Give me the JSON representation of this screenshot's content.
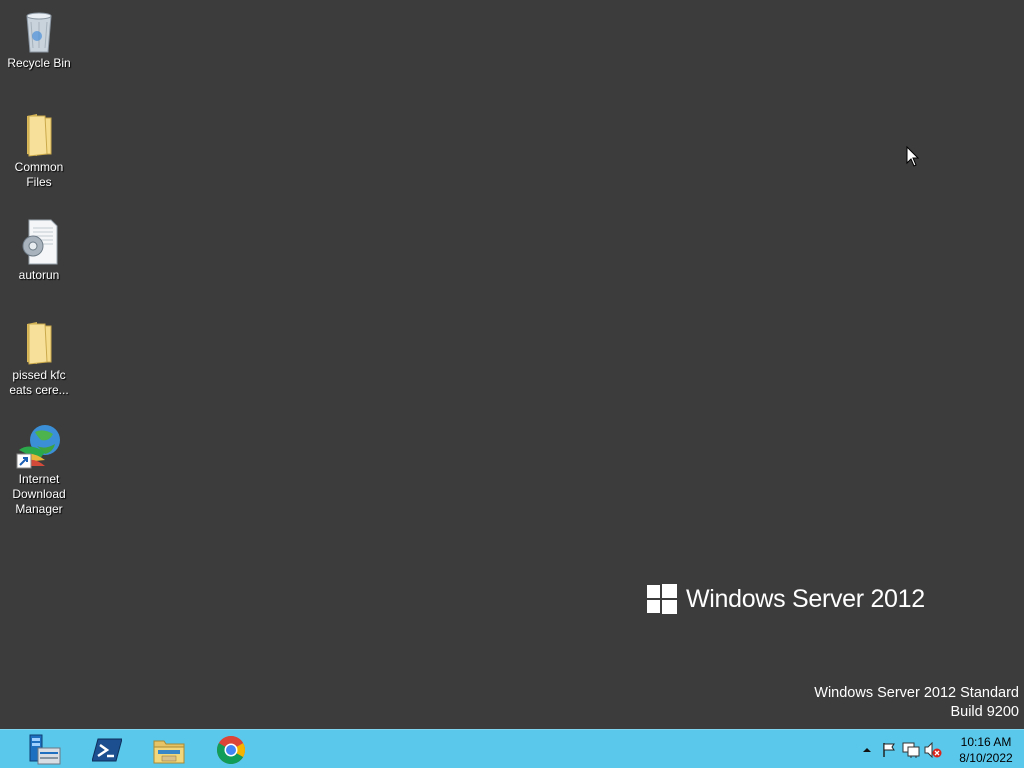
{
  "desktop": {
    "background_color": "#3c3c3c",
    "icons": [
      {
        "label": "Recycle Bin",
        "icon": "recycle-bin-icon"
      },
      {
        "label": "Common Files",
        "icon": "folder-icon"
      },
      {
        "label": "autorun",
        "icon": "settings-file-icon"
      },
      {
        "label": "pissed kfc eats cere...",
        "icon": "folder-icon"
      },
      {
        "label": "Internet Download Manager",
        "icon": "idm-shortcut-icon"
      }
    ]
  },
  "branding": {
    "logo_text": "Windows Server 2012",
    "edition_line1": "Windows Server 2012 Standard",
    "edition_line2": "Build 9200"
  },
  "taskbar": {
    "color": "#5ac8eb",
    "pinned": [
      {
        "name": "Server Manager",
        "icon": "server-manager-icon"
      },
      {
        "name": "Windows PowerShell",
        "icon": "powershell-icon"
      },
      {
        "name": "File Explorer",
        "icon": "file-explorer-icon"
      },
      {
        "name": "Google Chrome",
        "icon": "chrome-icon"
      }
    ],
    "tray": {
      "icons": [
        "show-hidden-icons-chevron",
        "action-center-flag-icon",
        "network-icon",
        "volume-muted-icon"
      ],
      "time": "10:16 AM",
      "date": "8/10/2022"
    }
  }
}
